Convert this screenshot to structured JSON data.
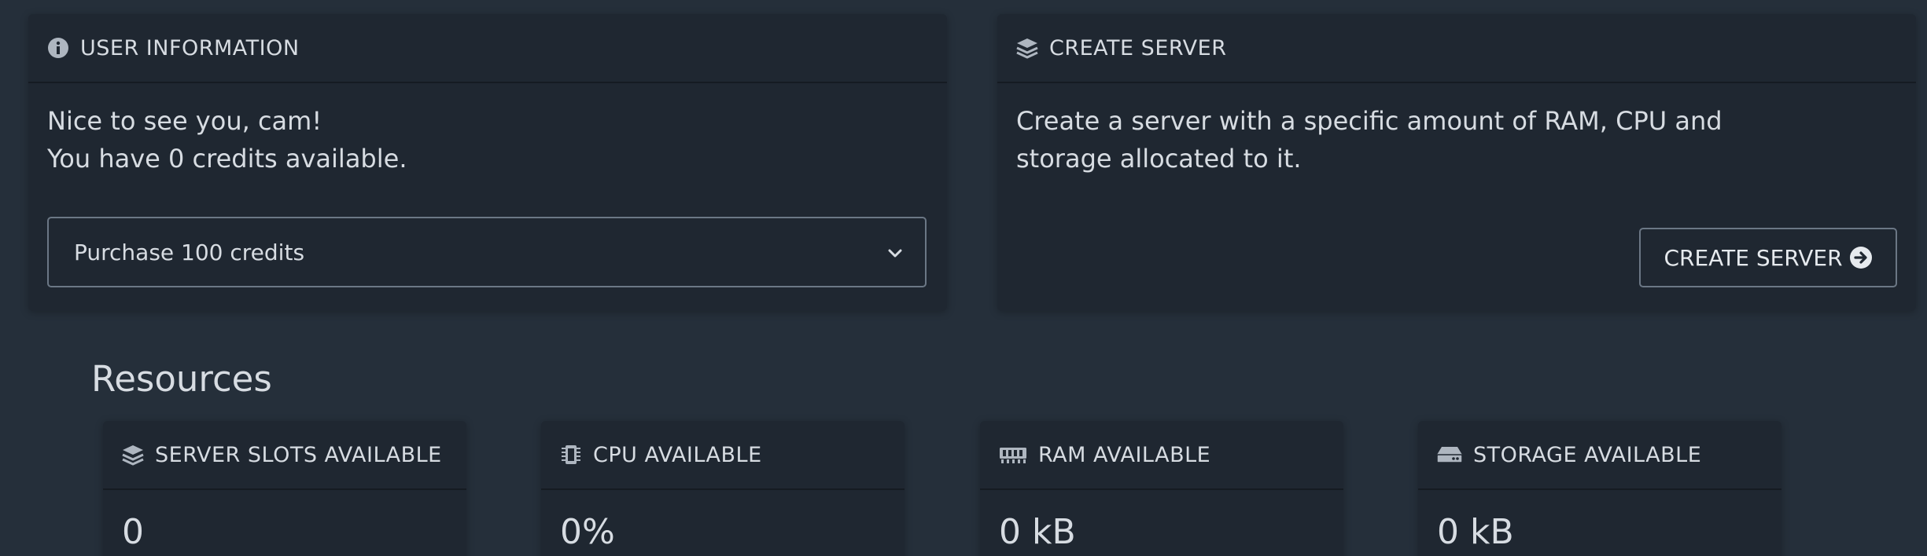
{
  "user_info": {
    "title": "USER INFORMATION",
    "greeting": "Nice to see you, cam!",
    "credits_text": "You have 0 credits available.",
    "purchase_select": "Purchase 100 credits",
    "icon": "info-circle-icon"
  },
  "create_server": {
    "title": "CREATE SERVER",
    "description": "Create a server with a specific amount of RAM, CPU and storage allocated to it.",
    "button_label": "CREATE SERVER",
    "icon": "layers-icon",
    "button_icon": "arrow-circle-right-icon"
  },
  "resources": {
    "title": "Resources",
    "items": [
      {
        "label": "SERVER SLOTS AVAILABLE",
        "value": "0",
        "icon": "layers-icon"
      },
      {
        "label": "CPU AVAILABLE",
        "value": "0%",
        "icon": "cpu-chip-icon"
      },
      {
        "label": "RAM AVAILABLE",
        "value": "0 kB",
        "icon": "memory-icon"
      },
      {
        "label": "STORAGE AVAILABLE",
        "value": "0 kB",
        "icon": "hard-drive-icon"
      }
    ]
  }
}
